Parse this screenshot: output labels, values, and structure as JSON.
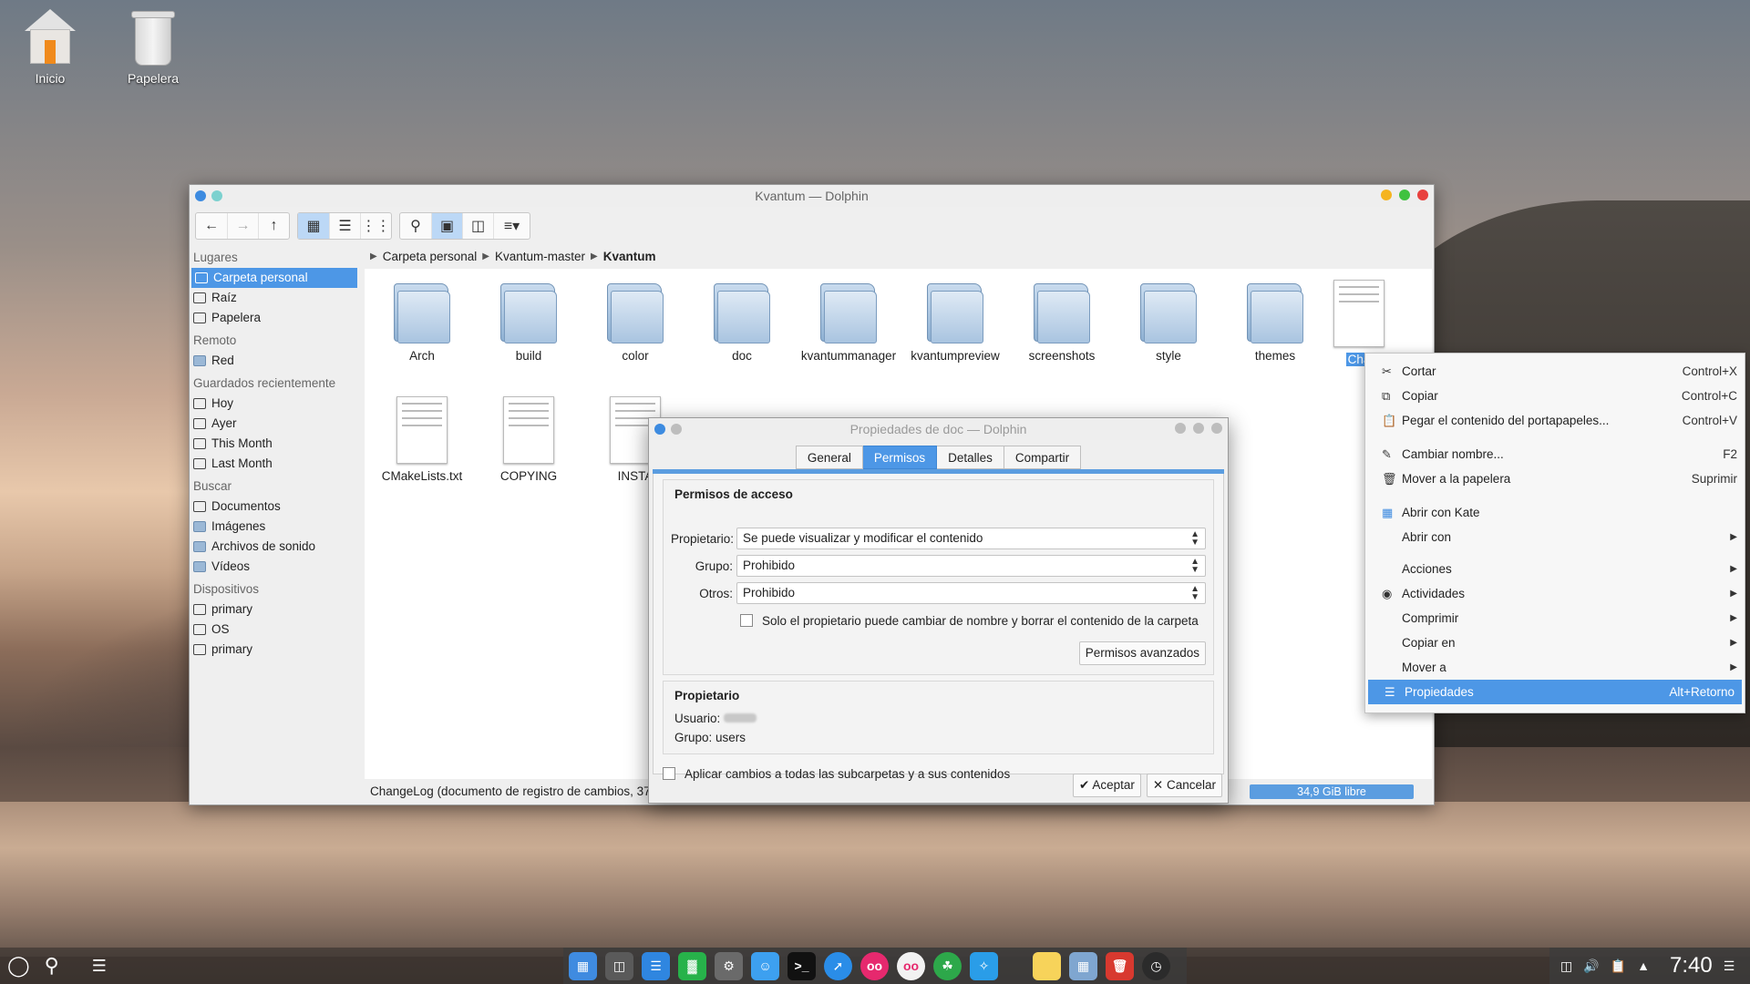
{
  "desktop": {
    "icons": [
      {
        "label": "Inicio"
      },
      {
        "label": "Papelera"
      }
    ]
  },
  "window": {
    "title": "Kvantum — Dolphin",
    "breadcrumb": [
      "Carpeta personal",
      "Kvantum-master",
      "Kvantum"
    ],
    "places": {
      "lugares": "Lugares",
      "lugares_items": [
        "Carpeta personal",
        "Raíz",
        "Papelera"
      ],
      "remoto": "Remoto",
      "remoto_items": [
        "Red"
      ],
      "recientes": "Guardados recientemente",
      "recientes_items": [
        "Hoy",
        "Ayer",
        "This Month",
        "Last Month"
      ],
      "buscar": "Buscar",
      "buscar_items": [
        "Documentos",
        "Imágenes",
        "Archivos de sonido",
        "Vídeos"
      ],
      "dispositivos": "Dispositivos",
      "dispositivos_items": [
        "primary",
        "OS",
        "primary"
      ]
    },
    "files_row1": [
      "Arch",
      "build",
      "color",
      "doc",
      "kvantummanager",
      "kvantumpreview",
      "screenshots",
      "style",
      "themes",
      "Cha"
    ],
    "files_row2": [
      "CMakeLists.txt",
      "COPYING",
      "INSTA"
    ],
    "status": "ChangeLog (documento de registro de cambios, 37",
    "free_space": "34,9 GiB libre"
  },
  "dialog": {
    "title": "Propiedades de doc — Dolphin",
    "tabs": [
      "General",
      "Permisos",
      "Detalles",
      "Compartir"
    ],
    "access_title": "Permisos de acceso",
    "owner_label": "Propietario:",
    "owner_value": "Se puede visualizar y modificar el contenido",
    "group_label": "Grupo:",
    "group_value": "Prohibido",
    "others_label": "Otros:",
    "others_value": "Prohibido",
    "only_owner": "Solo el propietario puede cambiar de nombre y borrar el contenido de la carpeta",
    "advanced": "Permisos avanzados",
    "owner_section": "Propietario",
    "user_label": "Usuario:",
    "group_line": "Grupo: users",
    "apply_all": "Aplicar cambios a todas las subcarpetas y a sus contenidos",
    "ok": "Aceptar",
    "cancel": "Cancelar"
  },
  "context_menu": {
    "items": [
      {
        "label": "Cortar",
        "shortcut": "Control+X",
        "icon": "scissors-icon"
      },
      {
        "label": "Copiar",
        "shortcut": "Control+C",
        "icon": "copy-icon"
      },
      {
        "label": "Pegar el contenido del portapapeles...",
        "shortcut": "Control+V",
        "icon": "clipboard-icon"
      },
      {
        "label": "Cambiar nombre...",
        "shortcut": "F2",
        "icon": "pencil-icon"
      },
      {
        "label": "Mover a la papelera",
        "shortcut": "Suprimir",
        "icon": "trash-icon"
      },
      {
        "label": "Abrir con Kate",
        "shortcut": "",
        "icon": "kate-icon"
      },
      {
        "label": "Abrir con",
        "shortcut": "",
        "icon": ""
      },
      {
        "label": "Acciones",
        "shortcut": "",
        "icon": ""
      },
      {
        "label": "Actividades",
        "shortcut": "",
        "icon": "activities-icon"
      },
      {
        "label": "Comprimir",
        "shortcut": "",
        "icon": ""
      },
      {
        "label": "Copiar en",
        "shortcut": "",
        "icon": ""
      },
      {
        "label": "Mover a",
        "shortcut": "",
        "icon": ""
      },
      {
        "label": "Propiedades",
        "shortcut": "Alt+Retorno",
        "icon": "properties-icon"
      }
    ]
  },
  "taskbar": {
    "clock": "7:40"
  },
  "colors": {
    "accent": "#4d97e6",
    "close": "#e8413e",
    "minimize": "#f5b41f",
    "maximize": "#3fc23f"
  }
}
